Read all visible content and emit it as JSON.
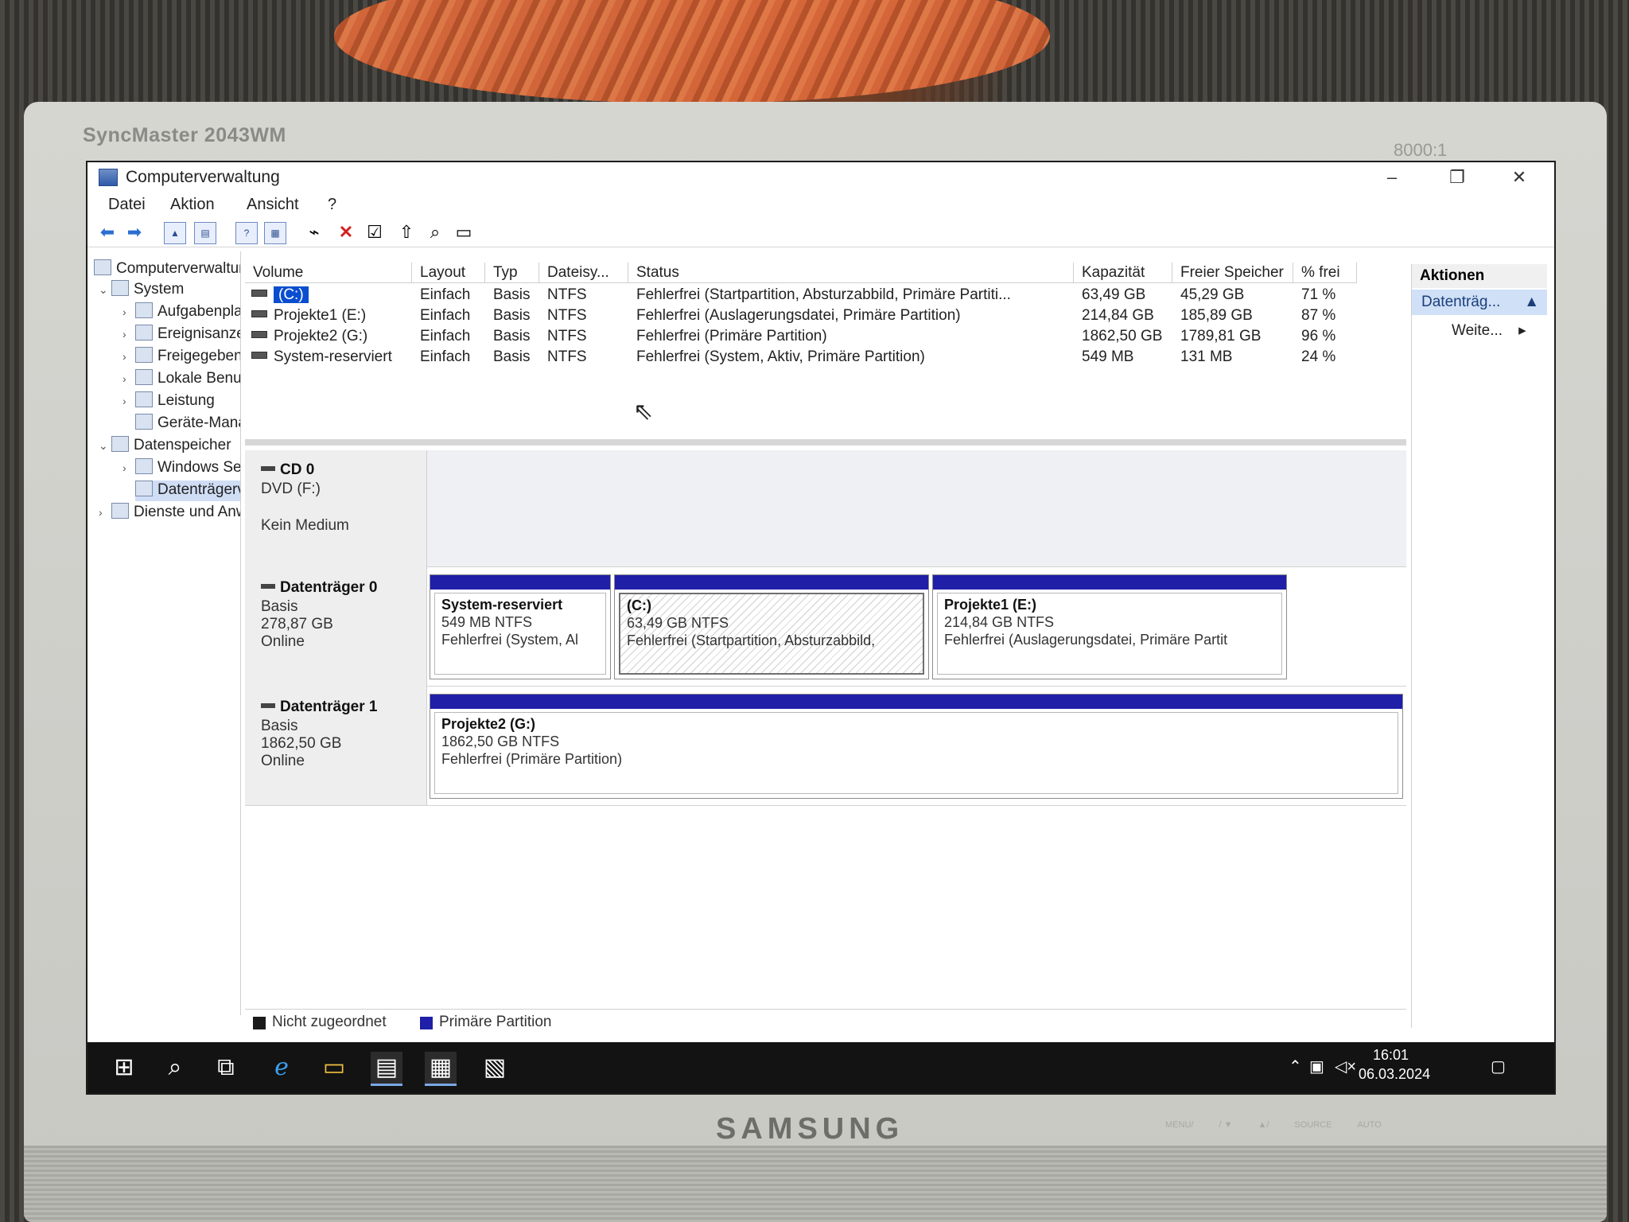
{
  "monitor": {
    "model": "SyncMaster 2043WM",
    "brand": "SAMSUNG",
    "contrast": "8000:1",
    "buttons": [
      "MENU/",
      "/ ▼",
      "▲/",
      "SOURCE",
      "AUTO"
    ]
  },
  "window": {
    "title": "Computerverwaltung",
    "minimize": "–",
    "maximize": "❐",
    "close": "✕"
  },
  "menu": {
    "datei": "Datei",
    "aktion": "Aktion",
    "ansicht": "Ansicht",
    "help": "?"
  },
  "tree": {
    "root": "Computerverwaltung (Lokal)",
    "system": "System",
    "aufgaben": "Aufgabenplanung",
    "ereignis": "Ereignisanzeige",
    "freigabe": "Freigegebene Ordner",
    "lokale": "Lokale Benutzer und Gruppen",
    "leistung": "Leistung",
    "geraete": "Geräte-Manager",
    "datenspeicher": "Datenspeicher",
    "windows": "Windows Server-Sicherung",
    "datentraeger": "Datenträgerverwaltung",
    "dienste": "Dienste und Anwendungen"
  },
  "table": {
    "headers": [
      "Volume",
      "Layout",
      "Typ",
      "Dateisy...",
      "Status",
      "Kapazität",
      "Freier Speicher",
      "% frei"
    ],
    "rows": [
      [
        "(C:)",
        "Einfach",
        "Basis",
        "NTFS",
        "Fehlerfrei (Startpartition, Absturzabbild, Primäre Partiti...",
        "63,49 GB",
        "45,29 GB",
        "71 %"
      ],
      [
        "Projekte1 (E:)",
        "Einfach",
        "Basis",
        "NTFS",
        "Fehlerfrei (Auslagerungsdatei, Primäre Partition)",
        "214,84 GB",
        "185,89 GB",
        "87 %"
      ],
      [
        "Projekte2 (G:)",
        "Einfach",
        "Basis",
        "NTFS",
        "Fehlerfrei (Primäre Partition)",
        "1862,50 GB",
        "1789,81 GB",
        "96 %"
      ],
      [
        "System-reserviert",
        "Einfach",
        "Basis",
        "NTFS",
        "Fehlerfrei (System, Aktiv, Primäre Partition)",
        "549 MB",
        "131 MB",
        "24 %"
      ]
    ]
  },
  "disks": {
    "cd": {
      "title": "CD 0",
      "line1": "DVD (F:)",
      "line2": "Kein Medium"
    },
    "d0": {
      "title": "Datenträger 0",
      "type": "Basis",
      "size": "278,87 GB",
      "state": "Online",
      "p1": {
        "name": "System-reserviert",
        "size": "549 MB NTFS",
        "status": "Fehlerfrei (System, Al"
      },
      "p2": {
        "name": "(C:)",
        "size": "63,49 GB NTFS",
        "status": "Fehlerfrei (Startpartition, Absturzabbild,"
      },
      "p3": {
        "name": "Projekte1  (E:)",
        "size": "214,84 GB NTFS",
        "status": "Fehlerfrei (Auslagerungsdatei, Primäre Partit"
      }
    },
    "d1": {
      "title": "Datenträger 1",
      "type": "Basis",
      "size": "1862,50 GB",
      "state": "Online",
      "p1": {
        "name": "Projekte2  (G:)",
        "size": "1862,50 GB NTFS",
        "status": "Fehlerfrei (Primäre Partition)"
      }
    }
  },
  "legend": {
    "unallocated": "Nicht zugeordnet",
    "primary": "Primäre Partition",
    "unallocated_color": "#1a1a1a",
    "primary_color": "#1f1fa8"
  },
  "actions": {
    "header": "Aktionen",
    "sub": "Datenträg...",
    "more": "Weite..."
  },
  "taskbar": {
    "time": "16:01",
    "date": "06.03.2024"
  }
}
